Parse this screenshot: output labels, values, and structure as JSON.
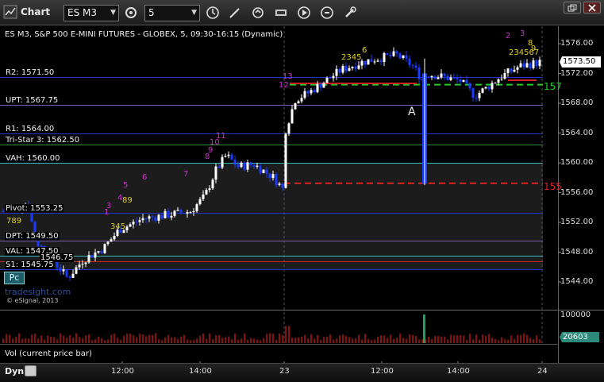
{
  "app": {
    "title": "Chart"
  },
  "toolbar": {
    "symbol": "ES M3",
    "interval": "5",
    "icons": [
      "chart-app-icon",
      "settings-gear-icon",
      "clock-icon",
      "draw-pencil-icon",
      "cursor-icon",
      "study-icon",
      "play-icon",
      "link-icon",
      "wrench-icon"
    ]
  },
  "window": {
    "restore_icon": "restore-icon",
    "close_icon": "close-icon"
  },
  "chart": {
    "title": "ES M3, S&P 500 E-MINI FUTURES - GLOBEX, 5, 09:30-16:15 (Dynamic)",
    "last_price": "1573.50",
    "y_ticks": [
      "1576.00",
      "1572.00",
      "1568.00",
      "1564.00",
      "1560.00",
      "1556.00",
      "1552.00",
      "1548.00",
      "1544.00"
    ],
    "x_ticks": [
      "12:00",
      "14:00",
      "23",
      "12:00",
      "14:00",
      "24"
    ],
    "levels": [
      {
        "label": "R2: 1571.50",
        "price": 1571.5,
        "color": "#2233cc"
      },
      {
        "label": "UPT: 1567.75",
        "price": 1567.75,
        "color": "#7a5fb0"
      },
      {
        "label": "R1: 1564.00",
        "price": 1564.0,
        "color": "#2233cc"
      },
      {
        "label": "Tri-Star 3: 1562.50",
        "price": 1562.5,
        "color": "#2b8a3a"
      },
      {
        "label": "VAH: 1560.00",
        "price": 1560.0,
        "color": "#33bbbb"
      },
      {
        "label": "Pivot: 1553.25",
        "price": 1553.25,
        "color": "#2233cc"
      },
      {
        "label": "DPT: 1549.50",
        "price": 1549.5,
        "color": "#7a5fb0"
      },
      {
        "label": "VAL: 1547.50",
        "price": 1547.5,
        "color": "#33bbbb"
      },
      {
        "label": "1546.75",
        "price": 1546.75,
        "color": "#cc2222"
      },
      {
        "label": "S1: 1545.75",
        "price": 1545.75,
        "color": "#2233cc"
      }
    ],
    "dashed_levels": [
      {
        "label": "157",
        "price": 1570.5,
        "color": "#22cc22"
      },
      {
        "label": "155",
        "price": 1557.25,
        "color": "#dd2222"
      }
    ],
    "annotation_a": "A",
    "pc_label": "Pc",
    "watermark": "tradesight.com",
    "copyright": "© eSignal, 2013"
  },
  "volume": {
    "label": "Vol (current price bar)",
    "y_tick": "100000",
    "current": "20603"
  },
  "bottom": {
    "dyn_label": "Dyn"
  },
  "colors": {
    "up_candle": "#ffffff",
    "down_candle": "#1a3cff",
    "volume": "#8a1010",
    "volume_spike": "#1fa05a"
  }
}
